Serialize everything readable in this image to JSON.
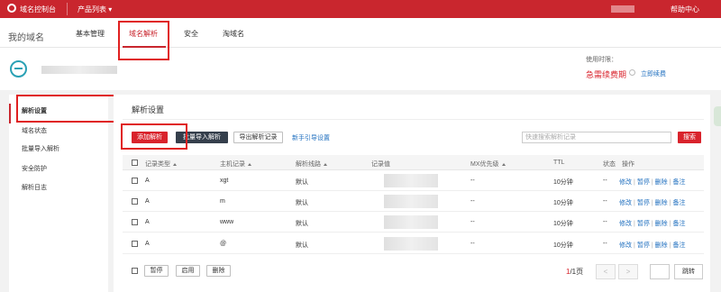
{
  "topbar": {
    "brand": "域名控制台",
    "products": "产品列表",
    "help": "帮助中心"
  },
  "header": {
    "my_domain": "我的域名",
    "tabs": [
      {
        "label": "基本管理"
      },
      {
        "label": "域名解析"
      },
      {
        "label": "安全"
      },
      {
        "label": "淘域名"
      }
    ],
    "usage_label": "使用时限：",
    "expire_text": "急需续费期",
    "renew_link": "立即续费"
  },
  "sidebar": {
    "items": [
      {
        "label": "解析设置"
      },
      {
        "label": "域名状态"
      },
      {
        "label": "批量导入解析"
      },
      {
        "label": "安全防护"
      },
      {
        "label": "解析日志"
      }
    ]
  },
  "content": {
    "title": "解析设置",
    "buttons": {
      "add": "添加解析",
      "batch_import": "批量导入解析",
      "export": "导出解析记录",
      "guide": "新手引导设置",
      "search": "搜索"
    },
    "search_placeholder": "快速搜索解析记录",
    "columns": [
      "记录类型",
      "主机记录",
      "解析线路",
      "记录值",
      "MX优先级",
      "TTL",
      "状态",
      "操作"
    ],
    "rows": [
      {
        "type": "A",
        "host": "xgt",
        "line": "默认",
        "mx": "--",
        "ttl": "10分钟",
        "status": "--"
      },
      {
        "type": "A",
        "host": "m",
        "line": "默认",
        "mx": "--",
        "ttl": "10分钟",
        "status": "--"
      },
      {
        "type": "A",
        "host": "www",
        "line": "默认",
        "mx": "--",
        "ttl": "10分钟",
        "status": "--"
      },
      {
        "type": "A",
        "host": "@",
        "line": "默认",
        "mx": "--",
        "ttl": "10分钟",
        "status": "--"
      }
    ],
    "row_ops": {
      "edit": "修改",
      "pause": "暂停",
      "delete": "删除",
      "note": "备注"
    },
    "footer": {
      "pause": "暂停",
      "enable": "启用",
      "delete": "删除"
    },
    "pager": {
      "current": "1",
      "total": "/1页",
      "prev": "<",
      "next": ">",
      "jump": "跳转"
    }
  },
  "colors": {
    "brand_red": "#c9262e",
    "link_blue": "#1f6fbf",
    "dark_button": "#353f4c"
  }
}
